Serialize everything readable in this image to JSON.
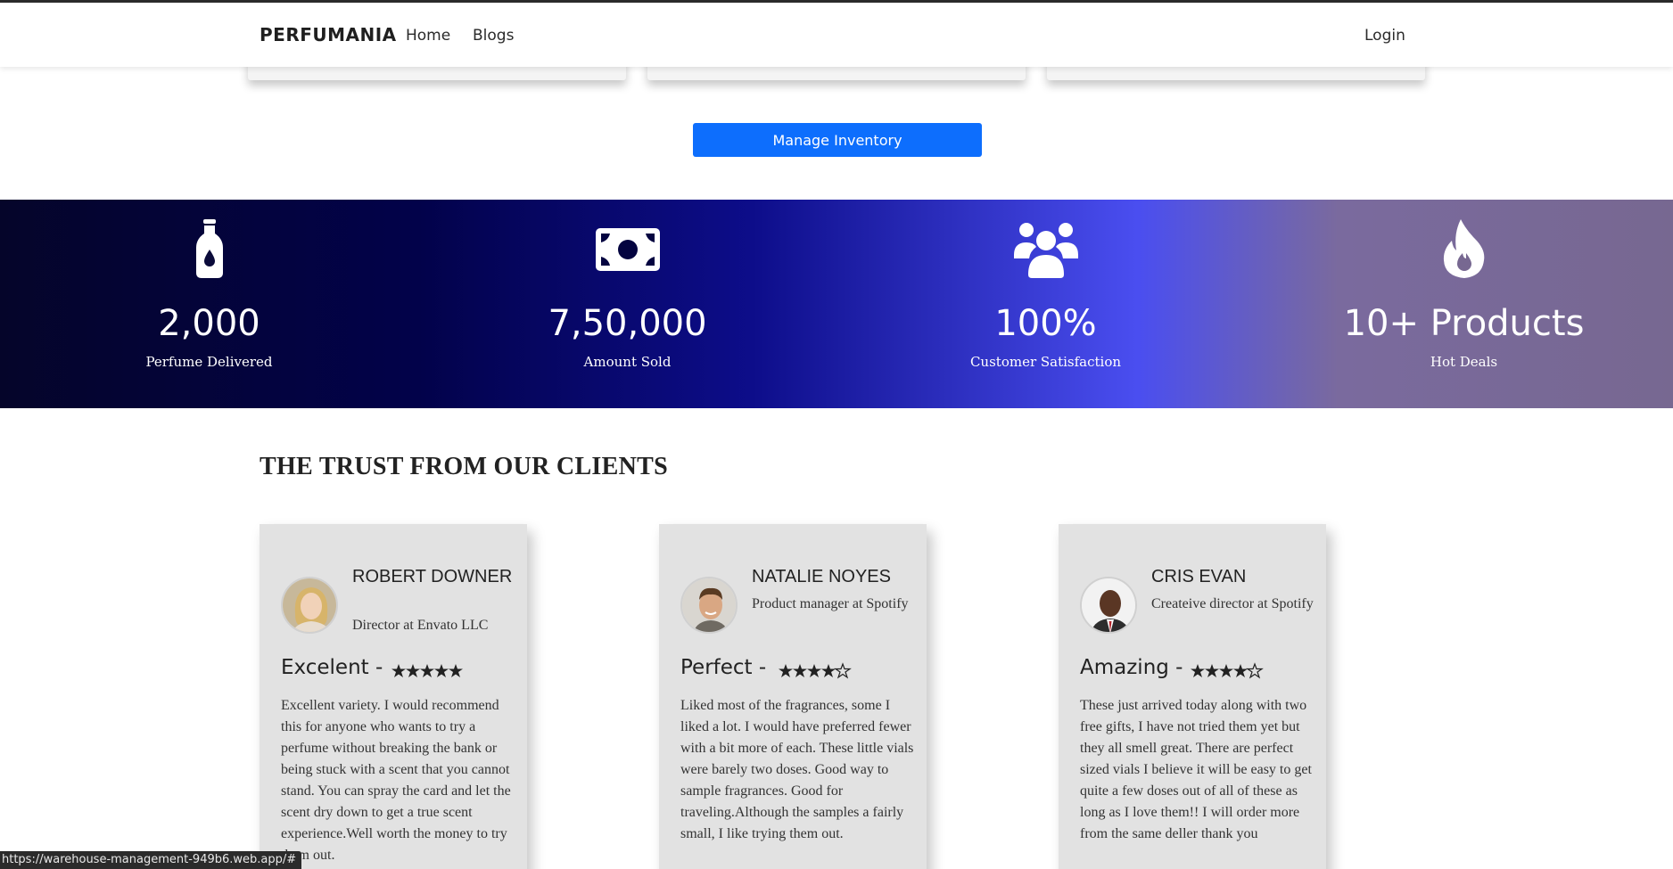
{
  "nav": {
    "brand": "PERFUMANIA",
    "home": "Home",
    "blogs": "Blogs",
    "login": "Login"
  },
  "manage_inventory_label": "Manage Inventory",
  "colors": {
    "primary_button": "#0d6efd",
    "review_card_bg": "#e2e2e2"
  },
  "stats": [
    {
      "icon": "perfume-bottle-icon",
      "value": "2,000",
      "label": "Perfume Delivered"
    },
    {
      "icon": "money-bill-icon",
      "value": "7,50,000",
      "label": "Amount Sold"
    },
    {
      "icon": "users-icon",
      "value": "100%",
      "label": "Customer Satisfaction"
    },
    {
      "icon": "fire-icon",
      "value": "10+ Products",
      "label": "Hot Deals"
    }
  ],
  "testimonials_title": "THE TRUST FROM OUR CLIENTS",
  "reviews": [
    {
      "name": "ROBERT DOWNER",
      "role": "Director at Envato LLC",
      "headline": "Excelent -",
      "rating": 5,
      "text": "Excellent variety. I would recommend this for anyone who wants to try a perfume without breaking the bank or being stuck with a scent that you cannot stand. You can spray the card and let the scent dry down to get a true scent experience.Well worth the money to try them out."
    },
    {
      "name": "NATALIE NOYES",
      "role": "Product manager at Spotify",
      "headline": "Perfect -",
      "rating": 4,
      "text": "Liked most of the fragrances, some I liked a lot. I would have preferred fewer with a bit more of each. These little vials were barely two doses. Good way to sample fragrances. Good for traveling.Although the samples a fairly small, I like trying them out."
    },
    {
      "name": "CRIS EVAN",
      "role": "Createive director at Spotify",
      "headline": "Amazing -",
      "rating": 4,
      "text": "These just arrived today along with two free gifts, I have not tried them yet but they all smell great. There are perfect sized vials I believe it will be easy to get quite a few doses out of all of these as long as I love them!! I will order more from the same deller thank you"
    }
  ],
  "status_url": "https://warehouse-management-949b6.web.app/#"
}
